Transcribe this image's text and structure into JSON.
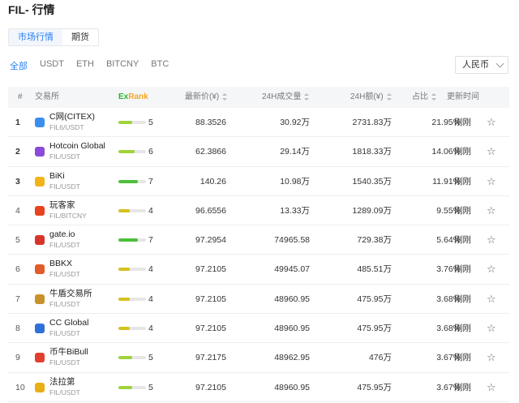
{
  "title": "FIL- 行情",
  "tabs": [
    {
      "label": "市场行情",
      "active": true
    },
    {
      "label": "期货",
      "active": false
    }
  ],
  "filters": [
    {
      "label": "全部",
      "active": true
    },
    {
      "label": "USDT",
      "active": false
    },
    {
      "label": "ETH",
      "active": false
    },
    {
      "label": "BITCNY",
      "active": false
    },
    {
      "label": "BTC",
      "active": false
    }
  ],
  "currency": "人民币",
  "columns": {
    "index": "#",
    "exchange": "交易所",
    "exrank_ex": "Ex",
    "exrank_rank": "Rank",
    "price": "最新价(¥)",
    "volume": "24H成交量",
    "amount": "24H额(¥)",
    "share": "占比",
    "updated": "更新时间"
  },
  "colors": {
    "accent": "#2a7ef2",
    "score_high": "#4cc03a",
    "score_mid": "#9fd33a",
    "score_low": "#d4c21e"
  },
  "rows": [
    {
      "rank": "1",
      "name": "C网(CITEX)",
      "pair": "FIL6/USDT",
      "logo": "citex-hex-icon",
      "logo_color": "#3a8ef0",
      "score": "5",
      "score_frac": 0.5,
      "bar_color": "#9fd33a",
      "price": "88.3526",
      "volume": "30.92万",
      "amount": "2731.83万",
      "share": "21.95%",
      "updated": "刚刚",
      "bold": true
    },
    {
      "rank": "2",
      "name": "Hotcoin Global",
      "pair": "FIL/USDT",
      "logo": "hotcoin-flame-icon",
      "logo_color": "#8a4bd8",
      "score": "6",
      "score_frac": 0.6,
      "bar_color": "#9fd33a",
      "price": "62.3866",
      "volume": "29.14万",
      "amount": "1818.33万",
      "share": "14.06%",
      "updated": "刚刚",
      "bold": true
    },
    {
      "rank": "3",
      "name": "BiKi",
      "pair": "FIL/USDT",
      "logo": "biki-icon",
      "logo_color": "#f2b318",
      "score": "7",
      "score_frac": 0.7,
      "bar_color": "#4cc03a",
      "price": "140.26",
      "volume": "10.98万",
      "amount": "1540.35万",
      "share": "11.91%",
      "updated": "刚刚",
      "bold": true
    },
    {
      "rank": "4",
      "name": "玩客家",
      "pair": "FIL/BITCNY",
      "logo": "wankejia-icon",
      "logo_color": "#e8421e",
      "score": "4",
      "score_frac": 0.4,
      "bar_color": "#d4c21e",
      "price": "96.6556",
      "volume": "13.33万",
      "amount": "1289.09万",
      "share": "9.55%",
      "updated": "刚刚",
      "bold": false
    },
    {
      "rank": "5",
      "name": "gate.io",
      "pair": "FIL/USDT",
      "logo": "gateio-icon",
      "logo_color": "#d9342b",
      "score": "7",
      "score_frac": 0.7,
      "bar_color": "#4cc03a",
      "price": "97.2954",
      "volume": "74965.58",
      "amount": "729.38万",
      "share": "5.64%",
      "updated": "刚刚",
      "bold": false
    },
    {
      "rank": "6",
      "name": "BBKX",
      "pair": "FIL/USDT",
      "logo": "bbkx-icon",
      "logo_color": "#e45b2b",
      "score": "4",
      "score_frac": 0.4,
      "bar_color": "#d4c21e",
      "price": "97.2105",
      "volume": "49945.07",
      "amount": "485.51万",
      "share": "3.76%",
      "updated": "刚刚",
      "bold": false
    },
    {
      "rank": "7",
      "name": "牛盾交易所",
      "pair": "FIL/USDT",
      "logo": "niudun-shield-icon",
      "logo_color": "#c8912b",
      "score": "4",
      "score_frac": 0.4,
      "bar_color": "#d4c21e",
      "price": "97.2105",
      "volume": "48960.95",
      "amount": "475.95万",
      "share": "3.68%",
      "updated": "刚刚",
      "bold": false
    },
    {
      "rank": "8",
      "name": "CC Global",
      "pair": "FIL/USDT",
      "logo": "ccglobal-icon",
      "logo_color": "#2f6fd8",
      "score": "4",
      "score_frac": 0.4,
      "bar_color": "#d4c21e",
      "price": "97.2105",
      "volume": "48960.95",
      "amount": "475.95万",
      "share": "3.68%",
      "updated": "刚刚",
      "bold": false
    },
    {
      "rank": "9",
      "name": "币牛BiBull",
      "pair": "FIL/USDT",
      "logo": "bibull-icon",
      "logo_color": "#e0402e",
      "score": "5",
      "score_frac": 0.5,
      "bar_color": "#9fd33a",
      "price": "97.2175",
      "volume": "48962.95",
      "amount": "476万",
      "share": "3.67%",
      "updated": "刚刚",
      "bold": false
    },
    {
      "rank": "10",
      "name": "法拉第",
      "pair": "FIL/USDT",
      "logo": "faladi-icon",
      "logo_color": "#e8b014",
      "score": "5",
      "score_frac": 0.5,
      "bar_color": "#9fd33a",
      "price": "97.2105",
      "volume": "48960.95",
      "amount": "475.95万",
      "share": "3.67%",
      "updated": "刚刚",
      "bold": false
    }
  ]
}
